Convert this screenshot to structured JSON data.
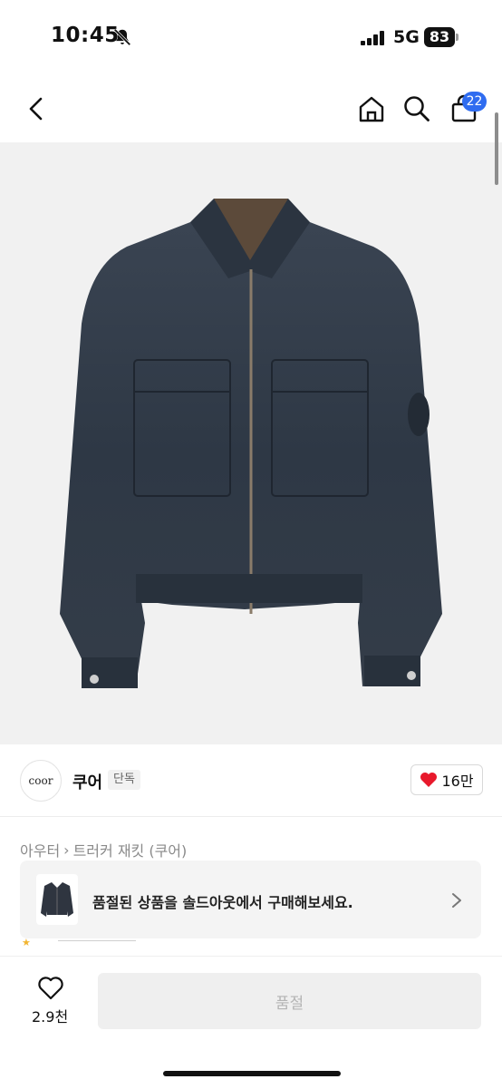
{
  "status_bar": {
    "time": "10:45",
    "network": "5G",
    "battery": "83"
  },
  "header": {
    "cart_count": "22"
  },
  "brand": {
    "logo_text": "coor",
    "name": "쿠어",
    "tag": "단독",
    "likes": "16만"
  },
  "breadcrumb": {
    "category": "아우터",
    "separator": "›",
    "product": "트러커 재킷 (쿠어)"
  },
  "soldout_banner": {
    "text": "품절된 상품을 솔드아웃에서 구매해보세요."
  },
  "bottom_bar": {
    "wish_count": "2.9천",
    "buy_label": "품절"
  },
  "colors": {
    "accent_blue": "#2f6cf0",
    "heart_red": "#e8192c",
    "denim": "#2e3845"
  }
}
